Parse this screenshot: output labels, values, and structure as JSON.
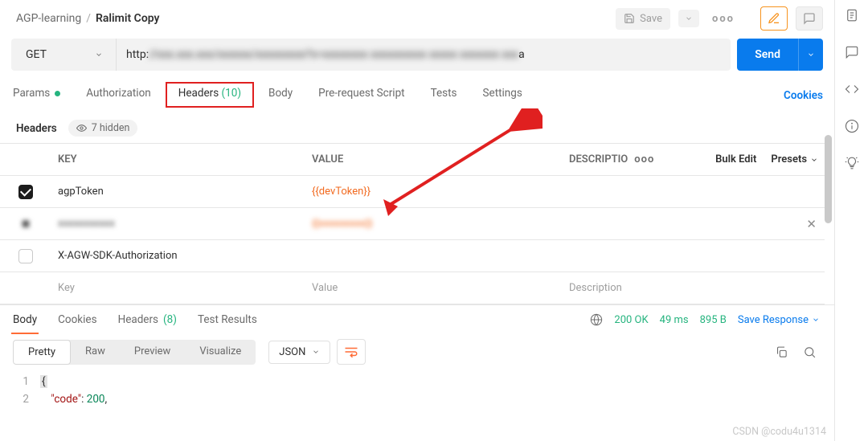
{
  "breadcrumbs": {
    "parent": "AGP-learning",
    "current": "Ralimit Copy"
  },
  "topbar": {
    "save": "Save"
  },
  "request": {
    "method": "GET",
    "url_prefix": "http:",
    "url_suffix": "a",
    "send": "Send"
  },
  "tabs": {
    "params": "Params",
    "auth": "Authorization",
    "headers": "Headers",
    "headers_count": "(10)",
    "body": "Body",
    "prereq": "Pre-request Script",
    "tests": "Tests",
    "settings": "Settings",
    "cookies": "Cookies"
  },
  "headers_section": {
    "title": "Headers",
    "hidden": "7 hidden",
    "col_key": "KEY",
    "col_value": "VALUE",
    "col_desc": "DESCRIPTIO",
    "bulk": "Bulk Edit",
    "presets": "Presets"
  },
  "headers_rows": {
    "r1_key": "agpToken",
    "r1_value": "{{devToken}}",
    "r3_key": "X-AGW-SDK-Authorization",
    "ph_key": "Key",
    "ph_value": "Value",
    "ph_desc": "Description"
  },
  "response_tabs": {
    "body": "Body",
    "cookies": "Cookies",
    "headers": "Headers",
    "headers_count": "(8)",
    "test_results": "Test Results"
  },
  "response_status": {
    "code": "200 OK",
    "time": "49 ms",
    "size": "895 B",
    "save": "Save Response"
  },
  "body_toolbar": {
    "pretty": "Pretty",
    "raw": "Raw",
    "preview": "Preview",
    "visualize": "Visualize",
    "lang": "JSON"
  },
  "code": {
    "l1_num": "1",
    "l1_text": "{",
    "l2_num": "2",
    "l2_key": "\"code\"",
    "l2_sep": ": ",
    "l2_val": "200",
    "l2_tail": ","
  },
  "watermark": "CSDN @codu4u1314"
}
